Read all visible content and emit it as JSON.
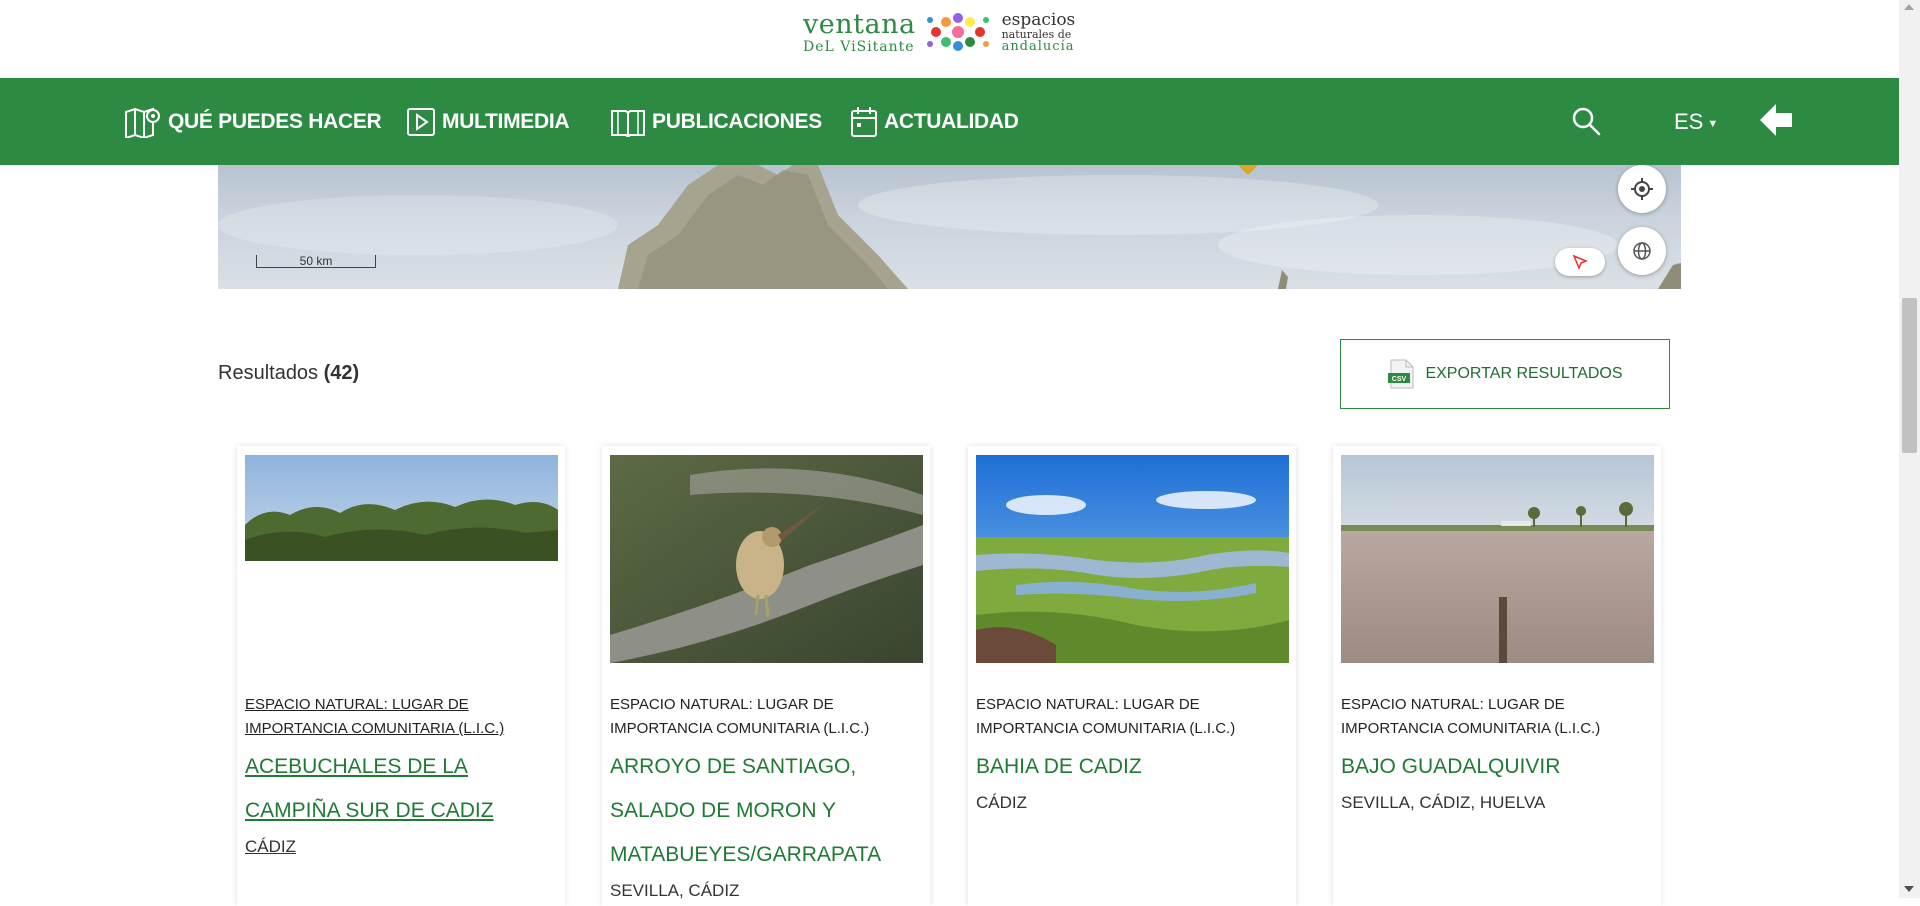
{
  "logo": {
    "ventana": "ventana",
    "del_visitante": "DeL ViSitante",
    "espacios": "espacios",
    "naturales_de": "naturales de",
    "andalucia": "andalucía"
  },
  "nav": {
    "items": [
      {
        "label": "QUÉ PUEDES HACER",
        "icon": "map-pin-icon"
      },
      {
        "label": "MULTIMEDIA",
        "icon": "play-icon"
      },
      {
        "label": "PUBLICACIONES",
        "icon": "book-icon"
      },
      {
        "label": "ACTUALIDAD",
        "icon": "calendar-icon"
      }
    ],
    "search_icon": "search-icon",
    "language": "ES",
    "back_icon": "arrow-left-icon"
  },
  "map": {
    "scale_label": "50 km",
    "locate_icon": "crosshair-icon",
    "globe_icon": "globe-icon",
    "select_icon": "cursor-select-icon"
  },
  "results": {
    "label": "Resultados",
    "count": "(42)",
    "export_label": "EXPORTAR RESULTADOS",
    "export_icon_text": "CSV"
  },
  "cards": [
    {
      "category": "ESPACIO NATURAL: LUGAR DE IMPORTANCIA COMUNITARIA (L.I.C.)",
      "title": "ACEBUCHALES DE LA CAMPIÑA SUR DE CADIZ",
      "province": "CÁDIZ"
    },
    {
      "category": "ESPACIO NATURAL: LUGAR DE IMPORTANCIA COMUNITARIA (L.I.C.)",
      "title": "ARROYO DE SANTIAGO, SALADO DE MORON Y MATABUEYES/GARRAPATA",
      "province": "SEVILLA, CÁDIZ"
    },
    {
      "category": "ESPACIO NATURAL: LUGAR DE IMPORTANCIA COMUNITARIA (L.I.C.)",
      "title": "BAHIA DE CADIZ",
      "province": "CÁDIZ"
    },
    {
      "category": "ESPACIO NATURAL: LUGAR DE IMPORTANCIA COMUNITARIA (L.I.C.)",
      "title": "BAJO GUADALQUIVIR",
      "province": "SEVILLA, CÁDIZ, HUELVA"
    }
  ],
  "colors": {
    "brand_green": "#2d8a43",
    "title_green": "#1f7a35"
  }
}
